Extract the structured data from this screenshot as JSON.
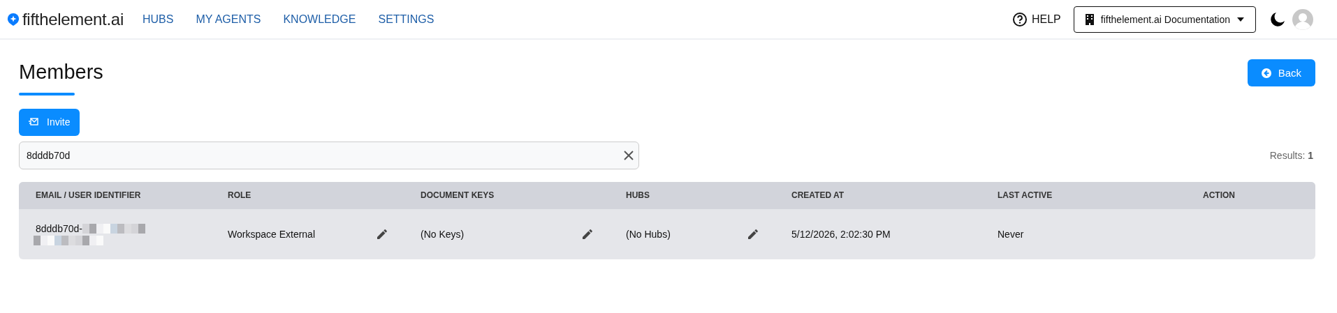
{
  "header": {
    "logo": "fifthelement.ai",
    "nav": [
      {
        "label": "HUBS"
      },
      {
        "label": "MY AGENTS"
      },
      {
        "label": "KNOWLEDGE"
      },
      {
        "label": "SETTINGS"
      }
    ],
    "help": "HELP",
    "workspace": "fifthelement.ai Documentation"
  },
  "page": {
    "title": "Members",
    "back": "Back",
    "invite": "Invite",
    "search": {
      "value": "8dddb70d"
    },
    "results_label": "Results:",
    "results_count": "1"
  },
  "table": {
    "columns": [
      "EMAIL / USER IDENTIFIER",
      "ROLE",
      "DOCUMENT KEYS",
      "HUBS",
      "CREATED AT",
      "LAST ACTIVE",
      "ACTION"
    ],
    "rows": [
      {
        "email": "8dddb70d-",
        "role": "Workspace External",
        "document_keys": "(No Keys)",
        "hubs": "(No Hubs)",
        "created_at": "5/12/2026, 2:02:30 PM",
        "last_active": "Never"
      }
    ]
  }
}
